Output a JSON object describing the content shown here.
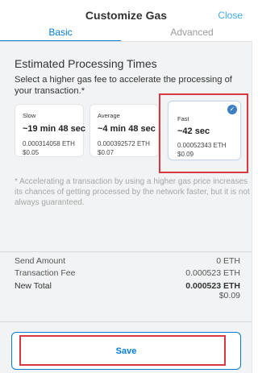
{
  "header": {
    "title": "Customize Gas",
    "close_label": "Close"
  },
  "tabs": [
    {
      "label": "Basic",
      "active": true
    },
    {
      "label": "Advanced",
      "active": false
    }
  ],
  "estimates": {
    "title": "Estimated Processing Times",
    "description": "Select a higher gas fee to accelerate the processing of your transaction.*",
    "options": [
      {
        "speed": "Slow",
        "time": "~19 min 48 sec",
        "eth": "0.000314058 ETH",
        "usd": "$0.05",
        "selected": false
      },
      {
        "speed": "Average",
        "time": "~4 min 48 sec",
        "eth": "0.000392572 ETH",
        "usd": "$0.07",
        "selected": false
      },
      {
        "speed": "Fast",
        "time": "~42 sec",
        "eth": "0.00052343 ETH",
        "usd": "$0.09",
        "selected": true
      }
    ],
    "selected_icon": "checkmark-icon",
    "note": "* Accelerating a transaction by using a higher gas price increases its chances of getting processed by the network faster, but it is not always guaranteed."
  },
  "summary": {
    "send_amount_label": "Send Amount",
    "send_amount_value": "0 ETH",
    "transaction_fee_label": "Transaction Fee",
    "transaction_fee_value": "0.000523 ETH",
    "new_total_label": "New Total",
    "new_total_value": "0.000523 ETH",
    "new_total_usd": "$0.09"
  },
  "footer": {
    "save_label": "Save"
  },
  "colors": {
    "accent": "#037dd6",
    "close_link": "#3fa9e8",
    "highlight": "#d8383f",
    "background": "#f2f3f4"
  }
}
